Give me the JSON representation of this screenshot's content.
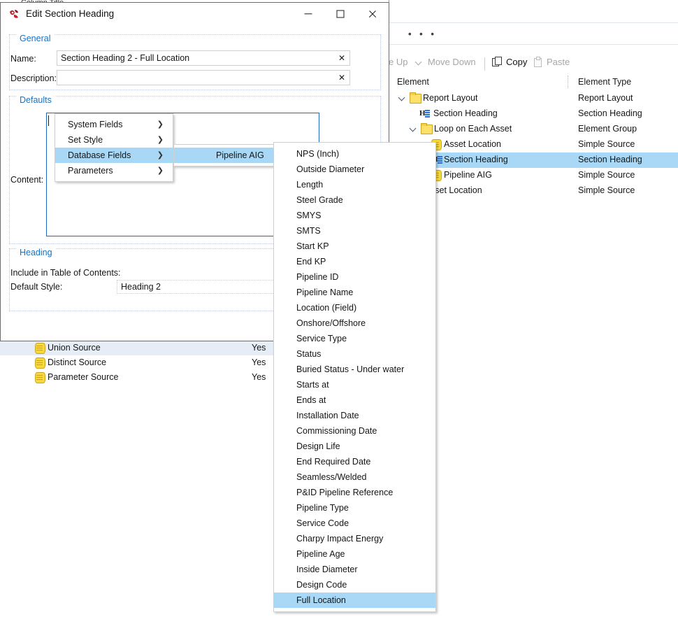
{
  "background": {
    "cut_row_text": "Column Title",
    "dots": "• • •",
    "toolbar": {
      "move_up": "e Up",
      "move_down": "Move Down",
      "copy": "Copy",
      "paste": "Paste"
    },
    "tree": {
      "col_element": "Element",
      "col_type": "Element Type",
      "rows": [
        {
          "label": "Report Layout",
          "type": "Report Layout"
        },
        {
          "label": "Section Heading",
          "type": "Section Heading"
        },
        {
          "label": "Loop on Each Asset",
          "type": "Element Group"
        },
        {
          "label": "Asset Location",
          "type": "Simple Source"
        },
        {
          "label": "Section Heading",
          "type": "Section Heading"
        },
        {
          "label": "Pipeline AIG",
          "type": "Simple Source"
        },
        {
          "label": "sset Location",
          "type": "Simple Source"
        }
      ]
    },
    "source_list": [
      {
        "name": "Union Source",
        "value": "Yes"
      },
      {
        "name": "Distinct Source",
        "value": "Yes"
      },
      {
        "name": "Parameter Source",
        "value": "Yes"
      }
    ]
  },
  "dialog": {
    "title": "Edit Section Heading",
    "groups": {
      "general": "General",
      "defaults": "Defaults",
      "heading": "Heading"
    },
    "labels": {
      "name": "Name:",
      "description": "Description:",
      "content": "Content:",
      "include_toc": "Include in Table of Contents:",
      "default_style": "Default Style:"
    },
    "fields": {
      "name_value": "Section Heading 2 - Full Location",
      "description_value": "",
      "description_placeholder": "",
      "clear_glyph": "✕",
      "default_style_value": "Heading 2"
    },
    "window_controls": {
      "minimize": "minimize",
      "maximize": "maximize",
      "close": "close"
    }
  },
  "menus": {
    "level1": [
      {
        "label": "System Fields",
        "arrow": "❯",
        "highlighted": false
      },
      {
        "label": "Set Style",
        "arrow": "❯",
        "highlighted": false
      },
      {
        "label": "Database Fields",
        "arrow": "❯",
        "highlighted": true
      },
      {
        "label": "Parameters",
        "arrow": "❯",
        "highlighted": false
      }
    ],
    "level2": [
      {
        "label": "Pipeline AIG",
        "arrow": "❯",
        "highlighted": true
      }
    ],
    "level3": [
      {
        "label": "NPS (Inch)",
        "highlighted": false
      },
      {
        "label": "Outside Diameter",
        "highlighted": false
      },
      {
        "label": "Length",
        "highlighted": false
      },
      {
        "label": "Steel Grade",
        "highlighted": false
      },
      {
        "label": "SMYS",
        "highlighted": false
      },
      {
        "label": "SMTS",
        "highlighted": false
      },
      {
        "label": "Start KP",
        "highlighted": false
      },
      {
        "label": "End KP",
        "highlighted": false
      },
      {
        "label": "Pipeline ID",
        "highlighted": false
      },
      {
        "label": "Pipeline Name",
        "highlighted": false
      },
      {
        "label": "Location (Field)",
        "highlighted": false
      },
      {
        "label": "Onshore/Offshore",
        "highlighted": false
      },
      {
        "label": "Service Type",
        "highlighted": false
      },
      {
        "label": "Status",
        "highlighted": false
      },
      {
        "label": "Buried Status - Under water",
        "highlighted": false
      },
      {
        "label": "Starts at",
        "highlighted": false
      },
      {
        "label": "Ends at",
        "highlighted": false
      },
      {
        "label": "Installation Date",
        "highlighted": false
      },
      {
        "label": "Commissioning Date",
        "highlighted": false
      },
      {
        "label": "Design Life",
        "highlighted": false
      },
      {
        "label": "End Required Date",
        "highlighted": false
      },
      {
        "label": "Seamless/Welded",
        "highlighted": false
      },
      {
        "label": "P&ID Pipeline Reference",
        "highlighted": false
      },
      {
        "label": "Pipeline Type",
        "highlighted": false
      },
      {
        "label": "Service Code",
        "highlighted": false
      },
      {
        "label": "Charpy Impact Energy",
        "highlighted": false
      },
      {
        "label": "Pipeline Age",
        "highlighted": false
      },
      {
        "label": "Inside Diameter",
        "highlighted": false
      },
      {
        "label": "Design Code",
        "highlighted": false
      },
      {
        "label": "Full Location",
        "highlighted": true
      }
    ]
  },
  "colors": {
    "menu_highlight": "#a8d8f5",
    "tree_selection": "#a8d8f5",
    "group_title": "#1673c4",
    "focus_border": "#1a6bbd",
    "folder_yellow": "#f6d040"
  }
}
